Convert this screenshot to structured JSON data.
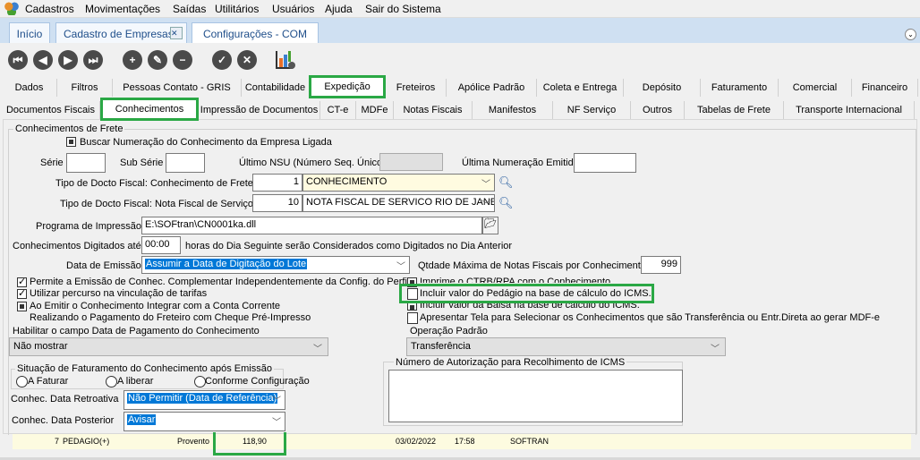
{
  "menubar": {
    "items": [
      "Cadastros",
      "Movimentações",
      "Saídas",
      "Utilitários",
      "Usuários",
      "Ajuda",
      "Sair do Sistema"
    ]
  },
  "doc_tabs": [
    "Início",
    "Cadastro de Empresas",
    "Configurações - COM"
  ],
  "toolbar": {
    "icons": [
      "first-record-icon",
      "previous-record-icon",
      "next-record-icon",
      "last-record-icon",
      "add-icon",
      "edit-icon",
      "remove-icon",
      "confirm-icon",
      "cancel-icon",
      "chart-settings-icon"
    ]
  },
  "main_tabs": [
    "Dados",
    "Filtros",
    "Pessoas Contato - GRIS",
    "Contabilidade",
    "Expedição",
    "Freteiros",
    "Apólice Padrão",
    "Coleta e Entrega",
    "Depósito",
    "Faturamento",
    "Comercial",
    "Financeiro"
  ],
  "sub_tabs": [
    "Documentos Fiscais",
    "Conhecimentos",
    "Impressão de Documentos",
    "CT-e",
    "MDFe",
    "Notas Fiscais",
    "Manifestos",
    "NF Serviço",
    "Outros",
    "Tabelas de Frete",
    "Transporte Internacional"
  ],
  "form": {
    "group_title": "Conhecimentos de Frete",
    "buscar": "Buscar Numeração do Conhecimento da Empresa Ligada",
    "serie": "Série",
    "sub_serie": "Sub Série",
    "ultimo_nsu": "Último NSU (Número Seq. Único)",
    "ultima_num": "Última Numeração Emitida",
    "tipo_cf_label": "Tipo de Docto Fiscal: Conhecimento de Frete",
    "tipo_cf_code": "1",
    "tipo_cf_value": "CONHECIMENTO",
    "tipo_nf_label": "Tipo de Docto Fiscal: Nota Fiscal de Serviço",
    "tipo_nf_code": "10",
    "tipo_nf_value": "NOTA FISCAL DE SERVICO RIO DE JANE",
    "programa_label": "Programa de Impressão",
    "programa_value": "E:\\SOFtran\\CN0001ka.dll",
    "digitados_label": "Conhecimentos Digitados até",
    "digitados_value": "00:00",
    "digitados_suffix": "horas do Dia Seguinte serão Considerados como Digitados no Dia Anterior",
    "data_emissao_label": "Data de Emissão",
    "data_emissao_value": "Assumir a Data de Digitação do Lote",
    "qtd_label": "Qtdade Máxima de Notas Fiscais por Conhecimento",
    "qtd_value": "999",
    "chk_permite": "Permite a Emissão de Conhec. Complementar Independentemente da Config. do Perfil",
    "chk_percurso": "Utilizar percurso na vinculação de tarifas",
    "chk_conta1": "Ao Emitir o Conhecimento Integrar com a Conta Corrente",
    "chk_conta2": "Realizando o Pagamento do Freteiro com Cheque Pré-Impresso",
    "chk_imprime": "Imprime o CTRB/RPA com o Conhecimento",
    "chk_pedagio": "Incluir valor do Pedágio na base de cálculo do ICMS.",
    "chk_balsa": "Incluir valor da Balsa na base de cálculo do ICMS.",
    "chk_apresentar": "Apresentar Tela para Selecionar os Conhecimentos que são Transferência ou Entr.Direta ao gerar MDF-e",
    "hab_label": "Habilitar o campo Data de Pagamento do Conhecimento",
    "hab_value": "Não mostrar",
    "op_label": "Operação Padrão",
    "op_value": "Transferência",
    "sit_title": "Situação de Faturamento do Conhecimento após Emissão",
    "radios": [
      "A Faturar",
      "A liberar",
      "Conforme Configuração"
    ],
    "retro_label": "Conhec. Data Retroativa",
    "retro_value": "Não Permitir (Data de Referência)",
    "post_label": "Conhec. Data Posterior",
    "post_value": "Avisar",
    "icms_title": "Número de Autorização para Recolhimento de ICMS"
  },
  "grid_row": {
    "num": "7",
    "desc": "PEDAGIO(+)",
    "tipo": "Provento",
    "valor": "118,90",
    "data": "03/02/2022",
    "hora": "17:58",
    "usuario": "SOFTRAN"
  },
  "colors": {
    "highlight": "#2aa845",
    "selection": "#0078d7"
  }
}
